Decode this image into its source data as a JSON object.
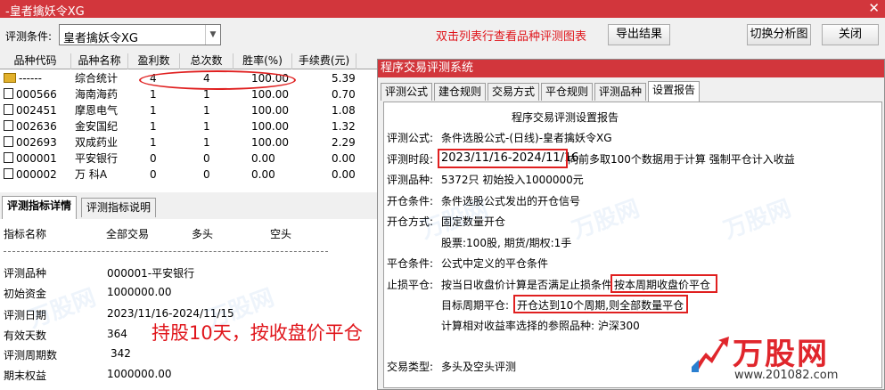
{
  "window": {
    "title": "-皇者擒妖令XG",
    "close_glyph": "✕"
  },
  "toolbar": {
    "label": "评测条件:",
    "condition_value": "皇者擒妖令XG",
    "hint": "双击列表行查看品种评测图表",
    "export_btn": "导出结果",
    "switch_btn": "切换分析图",
    "close_btn": "关闭"
  },
  "grid": {
    "columns": [
      "品种代码",
      "品种名称",
      "盈利数",
      "总次数",
      "胜率(%)",
      "手续费(元)"
    ],
    "rows": [
      {
        "code": "------",
        "name": "综合统计",
        "win": "4",
        "total": "4",
        "rate": "100.00",
        "fee": "5.39",
        "icon": "folder"
      },
      {
        "code": "000566",
        "name": "海南海药",
        "win": "1",
        "total": "1",
        "rate": "100.00",
        "fee": "0.70",
        "icon": "checkbox"
      },
      {
        "code": "002451",
        "name": "摩恩电气",
        "win": "1",
        "total": "1",
        "rate": "100.00",
        "fee": "1.08",
        "icon": "checkbox"
      },
      {
        "code": "002636",
        "name": "金安国纪",
        "win": "1",
        "total": "1",
        "rate": "100.00",
        "fee": "1.32",
        "icon": "checkbox"
      },
      {
        "code": "002693",
        "name": "双成药业",
        "win": "1",
        "total": "1",
        "rate": "100.00",
        "fee": "2.29",
        "icon": "checkbox"
      },
      {
        "code": "000001",
        "name": "平安银行",
        "win": "0",
        "total": "0",
        "rate": "0.00",
        "fee": "0.00",
        "icon": "checkbox"
      },
      {
        "code": "000002",
        "name": "万 科A",
        "win": "0",
        "total": "0",
        "rate": "0.00",
        "fee": "0.00",
        "icon": "checkbox"
      }
    ]
  },
  "bottom_tabs": [
    "评测指标详情",
    "评测指标说明"
  ],
  "detail": {
    "headers": [
      "指标名称",
      "全部交易",
      "多头",
      "空头"
    ],
    "items": [
      {
        "label": "评测品种",
        "value": "000001-平安银行"
      },
      {
        "label": "初始资金",
        "value": "1000000.00"
      },
      {
        "label": "评测日期",
        "value": "2023/11/16-2024/11/15"
      },
      {
        "label": "有效天数",
        "value": "364"
      },
      {
        "label": "评测周期数",
        "value": "342"
      },
      {
        "label": "期末权益",
        "value": "1000000.00"
      }
    ]
  },
  "annotation": "持股10天，按收盘价平仓",
  "dialog": {
    "title": "程序交易评测系统",
    "tabs": [
      "评测公式",
      "建仓规则",
      "交易方式",
      "平仓规则",
      "评测品种",
      "设置报告"
    ],
    "report": {
      "heading": "程序交易评测设置报告",
      "formula_label": "评测公式:",
      "formula_value": "条件选股公式-(日线)-皇者擒妖令XG",
      "period_label": "评测时段:",
      "period_value": "2023/11/16-2024/11/16",
      "period_note": "向前多取100个数据用于计算 强制平仓计入收益",
      "variety_label": "评测品种:",
      "variety_value": "5372只 初始投入1000000元",
      "open_cond_label": "开仓条件:",
      "open_cond_value": "条件选股公式发出的开仓信号",
      "open_mode_label": "开仓方式:",
      "open_mode_value": "固定数量开仓",
      "open_qty": "股票:100股, 期货/期权:1手",
      "close_cond_label": "平仓条件:",
      "close_cond_value": "公式中定义的平仓条件",
      "stop_label": "止损平仓:",
      "stop_value": "按当日收盘价计算是否满足止损条件",
      "stop_highlight": "按本周期收盘价平仓",
      "target_label": "目标周期平仓:",
      "target_value": "开仓达到10个周期,则全部数量平仓",
      "benchmark": "计算相对收益率选择的参照品种: 沪深300",
      "trade_type_label": "交易类型:",
      "trade_type_value": "多头及空头评测"
    }
  },
  "logo": {
    "name": "万股网",
    "url": "www.201082.com"
  },
  "colors": {
    "title_bar": "#d2363c",
    "annotation": "#e0151b",
    "highlight_box": "#e02020"
  }
}
